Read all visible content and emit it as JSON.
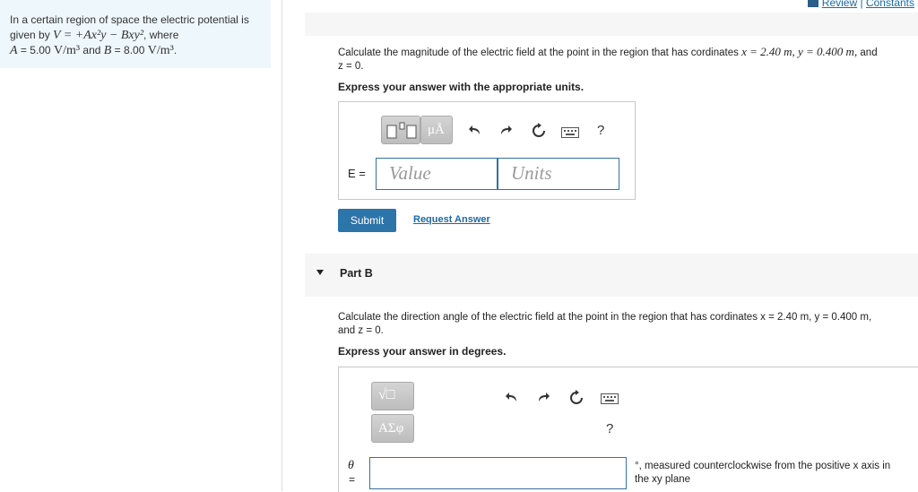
{
  "header": {
    "review": "Review",
    "separator": "|",
    "constants": "Constants"
  },
  "problem": {
    "line1": "In a certain region of space the electric potential is",
    "line2_prefix": "given by",
    "line2_formula": "V = +Ax²y − Bxy²",
    "line2_suffix": ", where",
    "A_label": "A",
    "A_value": "= 5.00",
    "A_unit": "V/m³",
    "and_word": "and",
    "B_label": "B",
    "B_value": "= 8.00",
    "B_unit": "V/m³",
    "period": "."
  },
  "part_a": {
    "question_line1_prefix": "Calculate the magnitude of the electric field at the point in the region that has cordinates",
    "question_x": "x = 2.40 m, y = 0.400 m,",
    "question_and": "and",
    "question_line2": "z = 0.",
    "instruction": "Express your answer with the appropriate units.",
    "units_button": "μÅ",
    "help_symbol": "?",
    "variable_label": "E =",
    "value_placeholder": "Value",
    "units_placeholder": "Units",
    "submit_label": "Submit",
    "request_answer_label": "Request Answer"
  },
  "part_b": {
    "label": "Part B",
    "question_line1": "Calculate the direction angle of the electric field at the point in the region that has cordinates x = 2.40 m, y = 0.400 m,",
    "question_line2": "and z = 0.",
    "instruction": "Express your answer in degrees.",
    "sqrt_button": "√□",
    "greek_button": "ΑΣφ",
    "help_symbol": "?",
    "variable_label": "θ",
    "equals": "=",
    "suffix_line1": "°, measured counterclockwise from the positive x axis in",
    "suffix_line2": "the xy plane"
  },
  "icons": [
    "template-icon",
    "undo-icon",
    "redo-icon",
    "reset-icon",
    "keyboard-icon",
    "help-icon",
    "play-down-arrow-icon"
  ],
  "colors": {
    "link": "#1a6aa6",
    "submit": "#2d74a8",
    "panel": "#eef7fb",
    "field_border": "#3a6f9e"
  }
}
